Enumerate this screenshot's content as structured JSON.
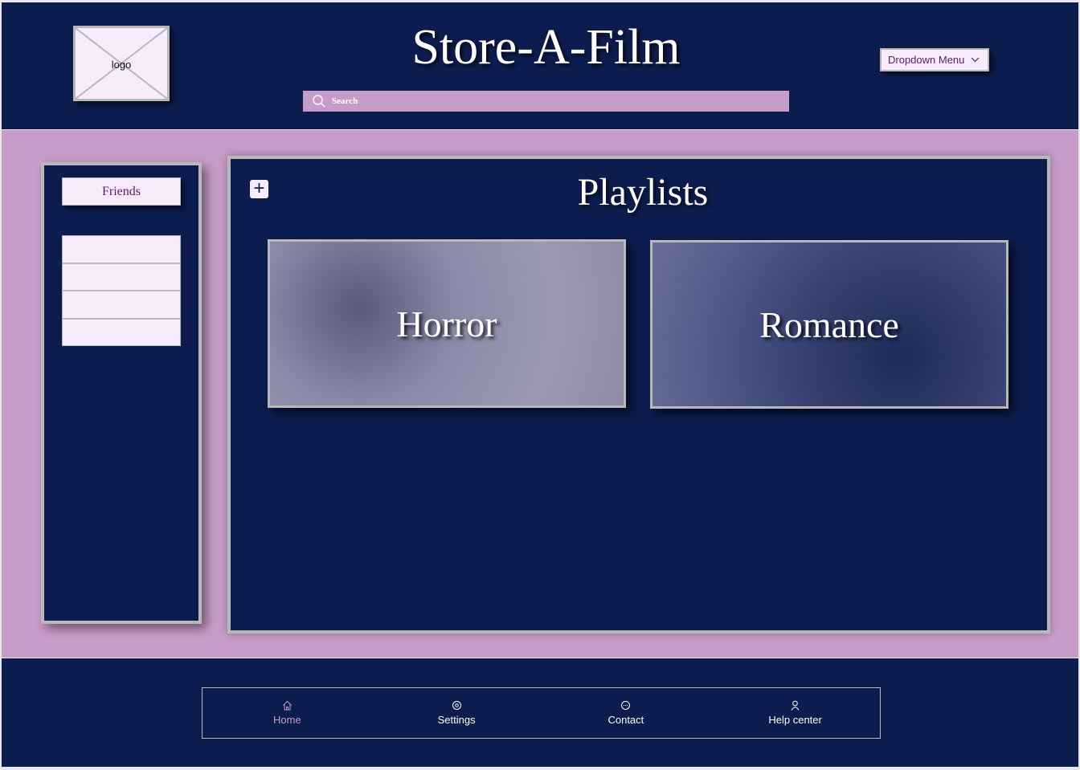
{
  "header": {
    "logo_label": "logo",
    "title": "Store-A-Film",
    "search": {
      "placeholder": "Search",
      "icon": "search-icon"
    },
    "dropdown_label": "Dropdown Menu"
  },
  "sidebar": {
    "friends_label": "Friends",
    "friend_slots": 4
  },
  "main": {
    "title": "Playlists",
    "add_icon": "plus-icon",
    "playlists": [
      {
        "label": "Horror"
      },
      {
        "label": "Romance"
      }
    ]
  },
  "footer": {
    "nav": [
      {
        "label": "Home",
        "icon": "home-icon",
        "active": true
      },
      {
        "label": "Settings",
        "icon": "settings-icon"
      },
      {
        "label": "Contact",
        "icon": "chat-icon"
      },
      {
        "label": "Help center",
        "icon": "user-icon"
      }
    ]
  },
  "colors": {
    "navy": "#0c1c4e",
    "lavender": "#c89cc8",
    "light": "#f8ecfc",
    "purple_text": "#5a1a6a"
  }
}
